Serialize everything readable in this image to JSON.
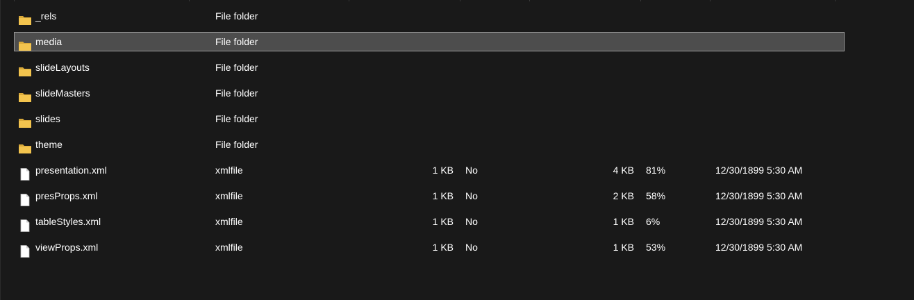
{
  "files": [
    {
      "name": "_rels",
      "type": "File folder",
      "size": "",
      "password_protected": "",
      "compressed_size": "",
      "ratio": "",
      "date_modified": "",
      "icon": "folder-icon",
      "selected": false
    },
    {
      "name": "media",
      "type": "File folder",
      "size": "",
      "password_protected": "",
      "compressed_size": "",
      "ratio": "",
      "date_modified": "",
      "icon": "folder-icon",
      "selected": true
    },
    {
      "name": "slideLayouts",
      "type": "File folder",
      "size": "",
      "password_protected": "",
      "compressed_size": "",
      "ratio": "",
      "date_modified": "",
      "icon": "folder-icon",
      "selected": false
    },
    {
      "name": "slideMasters",
      "type": "File folder",
      "size": "",
      "password_protected": "",
      "compressed_size": "",
      "ratio": "",
      "date_modified": "",
      "icon": "folder-icon",
      "selected": false
    },
    {
      "name": "slides",
      "type": "File folder",
      "size": "",
      "password_protected": "",
      "compressed_size": "",
      "ratio": "",
      "date_modified": "",
      "icon": "folder-icon",
      "selected": false
    },
    {
      "name": "theme",
      "type": "File folder",
      "size": "",
      "password_protected": "",
      "compressed_size": "",
      "ratio": "",
      "date_modified": "",
      "icon": "folder-icon",
      "selected": false
    },
    {
      "name": "presentation.xml",
      "type": "xmlfile",
      "size": "1 KB",
      "password_protected": "No",
      "compressed_size": "4 KB",
      "ratio": "81%",
      "date_modified": "12/30/1899 5:30 AM",
      "icon": "file-icon",
      "selected": false
    },
    {
      "name": "presProps.xml",
      "type": "xmlfile",
      "size": "1 KB",
      "password_protected": "No",
      "compressed_size": "2 KB",
      "ratio": "58%",
      "date_modified": "12/30/1899 5:30 AM",
      "icon": "file-icon",
      "selected": false
    },
    {
      "name": "tableStyles.xml",
      "type": "xmlfile",
      "size": "1 KB",
      "password_protected": "No",
      "compressed_size": "1 KB",
      "ratio": "6%",
      "date_modified": "12/30/1899 5:30 AM",
      "icon": "file-icon",
      "selected": false
    },
    {
      "name": "viewProps.xml",
      "type": "xmlfile",
      "size": "1 KB",
      "password_protected": "No",
      "compressed_size": "1 KB",
      "ratio": "53%",
      "date_modified": "12/30/1899 5:30 AM",
      "icon": "file-icon",
      "selected": false
    }
  ],
  "colors": {
    "background": "#191919",
    "text": "#ffffff",
    "selection_fill": "#4d4d4d",
    "selection_border": "#9a9a9a",
    "folder_yellow": "#f3c44e",
    "file_white": "#ffffff"
  }
}
